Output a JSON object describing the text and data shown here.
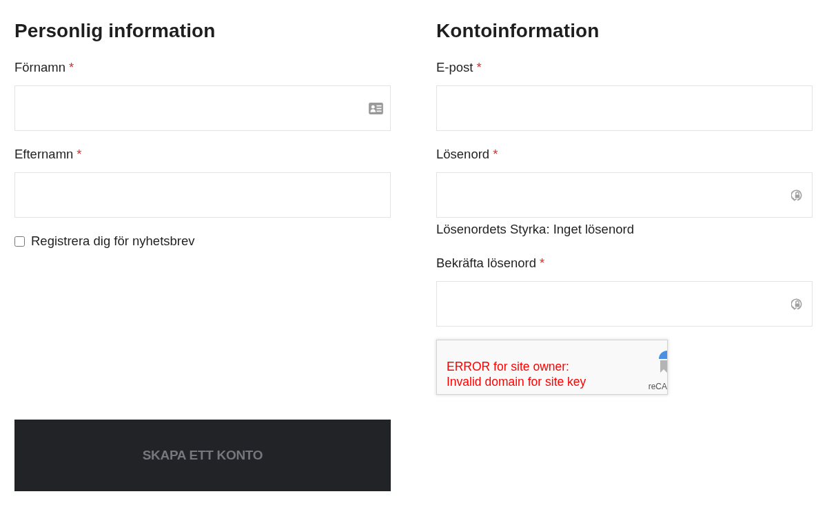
{
  "sections": [
    {
      "title": "Personlig information",
      "fields": [
        {
          "kind": "name",
          "label": "Förnamn",
          "required_mark": "*"
        },
        {
          "kind": "text",
          "label": "Efternamn",
          "required_mark": "*"
        },
        {
          "kind": "checkbox",
          "label": "Registrera dig för nyhetsbrev",
          "checked": false
        }
      ]
    },
    {
      "title": "Kontoinformation",
      "fields": [
        {
          "kind": "email",
          "label": "E-post",
          "required_mark": "*"
        },
        {
          "kind": "password",
          "label": "Lösenord",
          "required_mark": "*"
        },
        {
          "kind": "note",
          "text": "Lösenordets Styrka: Inget lösenord"
        },
        {
          "kind": "password",
          "label": "Bekräfta lösenord",
          "required_mark": "*"
        },
        {
          "kind": "captcha",
          "error_lines": [
            "ERROR for site owner:",
            "Invalid domain for site key"
          ],
          "brand_text": "reCA"
        }
      ]
    }
  ],
  "submit_button": {
    "label": "SKAPA ETT KONTO"
  }
}
